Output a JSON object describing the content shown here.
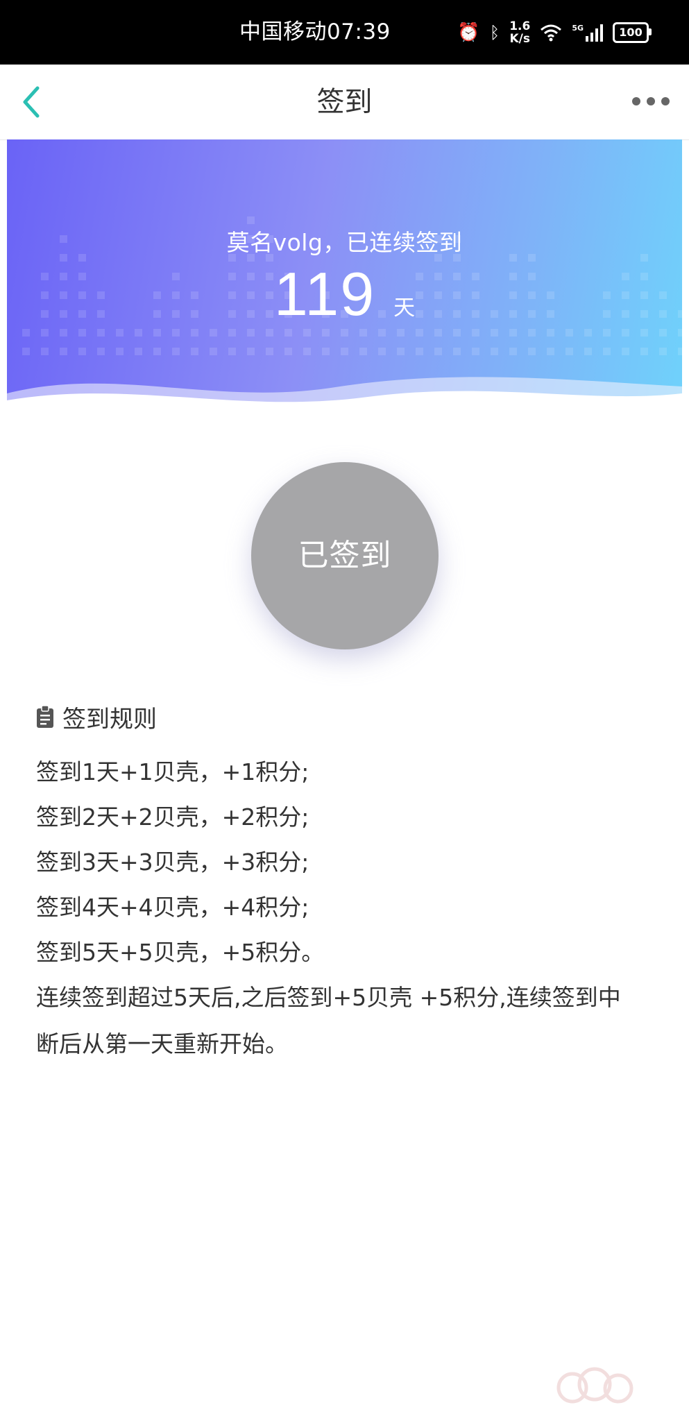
{
  "status_bar": {
    "carrier_time": "中国移动07:39",
    "speed_value": "1.6",
    "speed_unit": "K/s",
    "network": "5G",
    "battery": "100",
    "icons": [
      "alarm-icon",
      "bluetooth-icon",
      "wifi-icon",
      "signal-icon",
      "battery-icon"
    ]
  },
  "nav": {
    "title": "签到",
    "back_icon": "chevron-left-icon",
    "more_icon": "more-dots-icon"
  },
  "banner": {
    "greeting": "莫名volg，已连续签到",
    "streak_days": "119",
    "unit": "天"
  },
  "sign_button": {
    "label": "已签到"
  },
  "rules": {
    "title": "签到规则",
    "icon": "clipboard-icon",
    "lines": [
      "签到1天+1贝壳，+1积分;",
      "签到2天+2贝壳，+2积分;",
      "签到3天+3贝壳，+3积分;",
      "签到4天+4贝壳，+4积分;",
      "签到5天+5贝壳，+5积分。",
      "连续签到超过5天后,之后签到+5贝壳 +5积分,连续签到中",
      "断后从第一天重新开始。"
    ]
  },
  "colors": {
    "accent": "#2bbfb3",
    "banner_start": "#6a63f6",
    "banner_end": "#6fd2fb",
    "button_gray": "#a6a6a8"
  }
}
